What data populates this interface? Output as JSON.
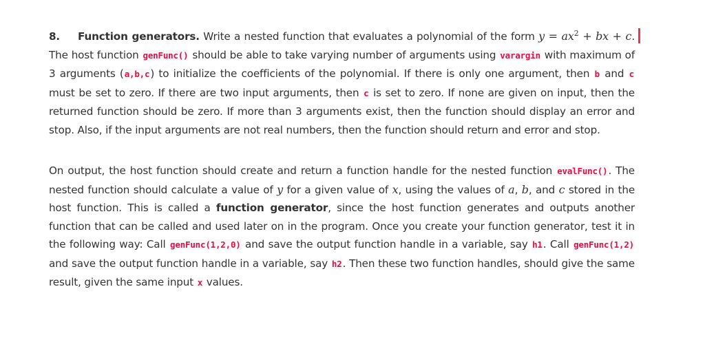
{
  "problem": {
    "number": "8.",
    "title": "Function generators.",
    "colors": {
      "code_text": "#dd1144",
      "code_bg": "#f7f7f9",
      "body_text": "#333333",
      "cursor": "#e8384f"
    },
    "p1": {
      "t1": " Write a nested function that evaluates a polynomial of the form ",
      "eq_y": "y",
      "eq_eq": " = ",
      "eq_a": "ax",
      "eq_sup": "2",
      "eq_plus1": " + ",
      "eq_b": "bx",
      "eq_plus2": " + ",
      "eq_c": "c",
      "t2": ". The host function ",
      "code_genfunc": "genFunc()",
      "t3": " should be able to take varying number of arguments using ",
      "code_varargin": "varargin",
      "t4": " with maximum of 3 arguments (",
      "code_abc": "a,b,c",
      "t5": ") to initialize the coefficients of the polynomial. If there is only one argument, then ",
      "code_b": "b",
      "t6": " and ",
      "code_c1": "c",
      "t7": " must be set to zero. If there are two input arguments, then ",
      "code_c2": "c",
      "t8": " is set to zero. If none are given on input, then the returned function should be zero. If more than 3 arguments exist, then the function should display an error and stop. Also, if the input arguments are not real numbers, then the function should return and error and stop."
    },
    "p2": {
      "t1": "On output, the host function should create and return a function handle for the nested function ",
      "code_evalfunc": "evalFunc()",
      "t2": ". The nested function should calculate a value of ",
      "m_y": "y",
      "t3": " for a given value of ",
      "m_x": "x",
      "t4": ", using the values of ",
      "m_a": "a",
      "t5": ", ",
      "m_b": "b",
      "t6": ", and ",
      "m_c": "c",
      "t7": " stored in the host function. This is called a ",
      "bold_fg": "function generator",
      "t8": ", since the host function generates and outputs another function that can be called and used later on in the program. Once you create your function generator, test it in the following way: Call ",
      "code_call1": "genFunc(1,2,0)",
      "t9": " and save the output function handle in a variable, say ",
      "code_h1": "h1",
      "t10": ". Call ",
      "code_call2": "genFunc(1,2)",
      "t11": " and save the output function handle in a variable, say ",
      "code_h2": "h2",
      "t12": ". Then these two function handles, should give the same result, given the same input ",
      "code_x": "x",
      "t13": " values."
    }
  }
}
